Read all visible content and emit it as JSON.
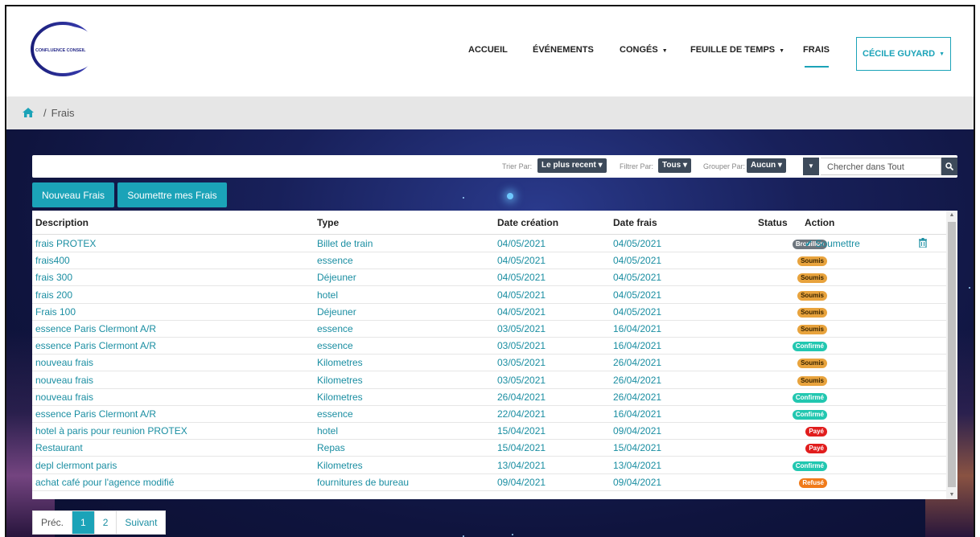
{
  "brand": {
    "logo_text": "CONFLUENCE CONSEIL"
  },
  "nav": {
    "items": [
      {
        "label": "ACCUEIL",
        "dropdown": false,
        "active": false
      },
      {
        "label": "ÉVÉNEMENTS",
        "dropdown": false,
        "active": false
      },
      {
        "label": "CONGÉS",
        "dropdown": true,
        "active": false
      },
      {
        "label": "FEUILLE DE TEMPS",
        "dropdown": true,
        "active": false
      },
      {
        "label": "FRAIS",
        "dropdown": false,
        "active": true
      }
    ],
    "user": "CÉCILE GUYARD"
  },
  "breadcrumb": {
    "current": "Frais",
    "separator": "/"
  },
  "toolbar": {
    "sort_label": "Trier Par:",
    "sort_value": "Le plus recent",
    "filter_label": "Filtrer Par:",
    "filter_value": "Tous",
    "group_label": "Grouper Par:",
    "group_value": "Aucun",
    "search_placeholder": "Chercher dans Tout"
  },
  "buttons": {
    "new": "Nouveau Frais",
    "submit_all": "Soumettre mes Frais"
  },
  "table": {
    "headers": {
      "description": "Description",
      "type": "Type",
      "created": "Date création",
      "date": "Date frais",
      "status": "Status",
      "action": "Action"
    },
    "action_label": "✔ Soumettre",
    "rows": [
      {
        "description": "frais PROTEX",
        "type": "Billet de train",
        "created": "04/05/2021",
        "date": "04/05/2021",
        "status": "Brouillon",
        "status_color": "#6c757d",
        "status_text_color": "#ffffff"
      },
      {
        "description": "frais400",
        "type": "essence",
        "created": "04/05/2021",
        "date": "04/05/2021",
        "status": "Soumis",
        "status_color": "#e8a33d",
        "status_text_color": "#3a2500"
      },
      {
        "description": "frais 300",
        "type": "Déjeuner",
        "created": "04/05/2021",
        "date": "04/05/2021",
        "status": "Soumis",
        "status_color": "#e8a33d",
        "status_text_color": "#3a2500"
      },
      {
        "description": "frais 200",
        "type": "hotel",
        "created": "04/05/2021",
        "date": "04/05/2021",
        "status": "Soumis",
        "status_color": "#e8a33d",
        "status_text_color": "#3a2500"
      },
      {
        "description": "Frais 100",
        "type": "Déjeuner",
        "created": "04/05/2021",
        "date": "04/05/2021",
        "status": "Soumis",
        "status_color": "#e8a33d",
        "status_text_color": "#3a2500"
      },
      {
        "description": "essence Paris Clermont A/R",
        "type": "essence",
        "created": "03/05/2021",
        "date": "16/04/2021",
        "status": "Soumis",
        "status_color": "#e8a33d",
        "status_text_color": "#3a2500"
      },
      {
        "description": "essence Paris Clermont A/R",
        "type": "essence",
        "created": "03/05/2021",
        "date": "16/04/2021",
        "status": "Confirmé",
        "status_color": "#22c7b0",
        "status_text_color": "#ffffff"
      },
      {
        "description": "nouveau frais",
        "type": "Kilometres",
        "created": "03/05/2021",
        "date": "26/04/2021",
        "status": "Soumis",
        "status_color": "#e8a33d",
        "status_text_color": "#3a2500"
      },
      {
        "description": "nouveau frais",
        "type": "Kilometres",
        "created": "03/05/2021",
        "date": "26/04/2021",
        "status": "Soumis",
        "status_color": "#e8a33d",
        "status_text_color": "#3a2500"
      },
      {
        "description": "nouveau frais",
        "type": "Kilometres",
        "created": "26/04/2021",
        "date": "26/04/2021",
        "status": "Confirmé",
        "status_color": "#22c7b0",
        "status_text_color": "#ffffff"
      },
      {
        "description": "essence Paris Clermont A/R",
        "type": "essence",
        "created": "22/04/2021",
        "date": "16/04/2021",
        "status": "Confirmé",
        "status_color": "#22c7b0",
        "status_text_color": "#ffffff"
      },
      {
        "description": "hotel à paris pour reunion PROTEX",
        "type": "hotel",
        "created": "15/04/2021",
        "date": "09/04/2021",
        "status": "Payé",
        "status_color": "#e11d1d",
        "status_text_color": "#ffffff"
      },
      {
        "description": "Restaurant",
        "type": "Repas",
        "created": "15/04/2021",
        "date": "15/04/2021",
        "status": "Payé",
        "status_color": "#e11d1d",
        "status_text_color": "#ffffff"
      },
      {
        "description": "depl clermont paris",
        "type": "Kilometres",
        "created": "13/04/2021",
        "date": "13/04/2021",
        "status": "Confirmé",
        "status_color": "#22c7b0",
        "status_text_color": "#ffffff"
      },
      {
        "description": "achat café pour l'agence modifié",
        "type": "fournitures de bureau",
        "created": "09/04/2021",
        "date": "09/04/2021",
        "status": "Refusé",
        "status_color": "#f07a1a",
        "status_text_color": "#ffffff"
      }
    ]
  },
  "pagination": {
    "prev": "Préc.",
    "pages": [
      "1",
      "2"
    ],
    "current": "1",
    "next": "Suivant"
  },
  "colors": {
    "accent": "#1ba3b8",
    "link": "#1a8ea2",
    "dark_control": "#3d4a5a"
  }
}
